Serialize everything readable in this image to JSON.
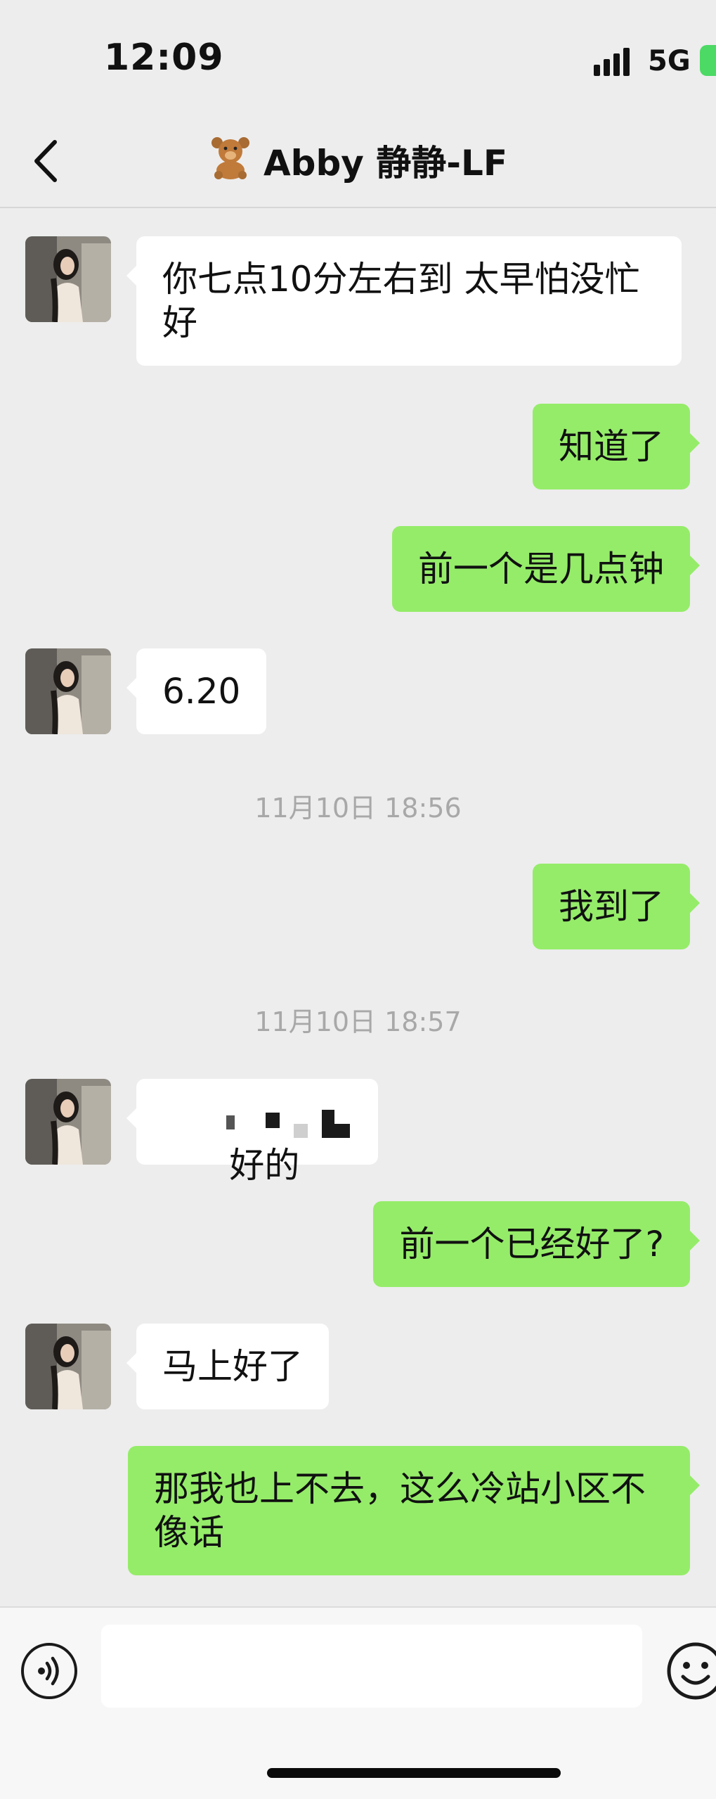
{
  "status_bar": {
    "time": "12:09",
    "network": "5G"
  },
  "header": {
    "contact_emoji": "🧸",
    "contact_name": "Abby 静静-LF"
  },
  "messages": [
    {
      "sender": "contact",
      "text": "你七点10分左右到 太早怕没忙好"
    },
    {
      "sender": "me",
      "text": "知道了"
    },
    {
      "sender": "me",
      "text": "前一个是几点钟"
    },
    {
      "sender": "contact",
      "text": "6.20"
    },
    {
      "type": "timestamp",
      "text": "11月10日 18:56"
    },
    {
      "sender": "me",
      "text": "我到了"
    },
    {
      "type": "timestamp",
      "text": "11月10日 18:57"
    },
    {
      "sender": "contact",
      "text": "好的"
    },
    {
      "sender": "me",
      "text": "前一个已经好了?"
    },
    {
      "sender": "contact",
      "text": "马上好了"
    },
    {
      "sender": "me",
      "text": "那我也上不去，这么冷站小区不像话"
    }
  ],
  "input": {
    "value": "",
    "placeholder": ""
  },
  "icons": {
    "back": "chevron-left-icon",
    "voice": "voice-icon",
    "emoji": "emoji-icon",
    "signal": "signal-icon",
    "battery": "battery-icon"
  },
  "colors": {
    "outgoing_bubble": "#95ec69",
    "incoming_bubble": "#ffffff",
    "background": "#ededed"
  }
}
